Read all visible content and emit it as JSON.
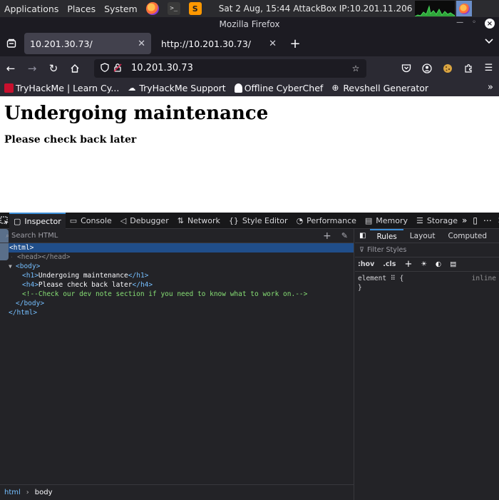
{
  "topbar": {
    "menus": [
      "Applications",
      "Places",
      "System"
    ],
    "clock": "Sat  2 Aug, 15:44",
    "ip_info": "AttackBox IP:10.201.11.206"
  },
  "window": {
    "title": "Mozilla Firefox"
  },
  "tabs": [
    {
      "label": "10.201.30.73/",
      "active": true
    },
    {
      "label": "http://10.201.30.73/",
      "active": false
    }
  ],
  "navbar": {
    "url": "10.201.30.73"
  },
  "bookmarks": [
    {
      "label": "TryHackMe | Learn Cy...",
      "icon": "tryhackme-icon",
      "color": "#c8102e"
    },
    {
      "label": "TryHackMe Support",
      "icon": "support-cloud-icon",
      "color": "#ffffff"
    },
    {
      "label": "Offline CyberChef",
      "icon": "chef-hat-icon",
      "color": "#ffffff"
    },
    {
      "label": "Revshell Generator",
      "icon": "globe-icon",
      "color": "#ffffff"
    }
  ],
  "page": {
    "h1": "Undergoing maintenance",
    "h4": "Please check back later"
  },
  "devtools": {
    "tabs": [
      {
        "label": "Inspector",
        "glyph": "▢",
        "selected": true,
        "name": "inspector"
      },
      {
        "label": "Console",
        "glyph": "▭",
        "selected": false,
        "name": "console"
      },
      {
        "label": "Debugger",
        "glyph": "◁",
        "selected": false,
        "name": "debugger"
      },
      {
        "label": "Network",
        "glyph": "⇅",
        "selected": false,
        "name": "network"
      },
      {
        "label": "Style Editor",
        "glyph": "{}",
        "selected": false,
        "name": "style-editor"
      },
      {
        "label": "Performance",
        "glyph": "◔",
        "selected": false,
        "name": "performance"
      },
      {
        "label": "Memory",
        "glyph": "▤",
        "selected": false,
        "name": "memory"
      },
      {
        "label": "Storage",
        "glyph": "☰",
        "selected": false,
        "name": "storage"
      }
    ],
    "search_placeholder": "Search HTML",
    "tree": {
      "html_open": "html",
      "head": "head",
      "body_open": "body",
      "h1_tag": "h1",
      "h1_text": "Undergoing maintenance",
      "h4_tag": "h4",
      "h4_text": "Please check back later",
      "comment": "<!--Check our dev note section if you need to know what to work on.-->",
      "body_close": "body",
      "html_close": "html"
    },
    "breadcrumbs": [
      "html",
      "body"
    ],
    "rules_tabs": [
      "Rules",
      "Layout",
      "Computed",
      "C"
    ],
    "filter_placeholder": "Filter Styles",
    "toggles": [
      ":hov",
      ".cls"
    ],
    "rule": {
      "selector": "element",
      "open": "{",
      "close": "}",
      "origin": "inline"
    }
  },
  "colors": {
    "accent": "#3b8dd7",
    "selected_row": "#204e8a",
    "tag": "#75bfff",
    "comment": "#86de74"
  }
}
